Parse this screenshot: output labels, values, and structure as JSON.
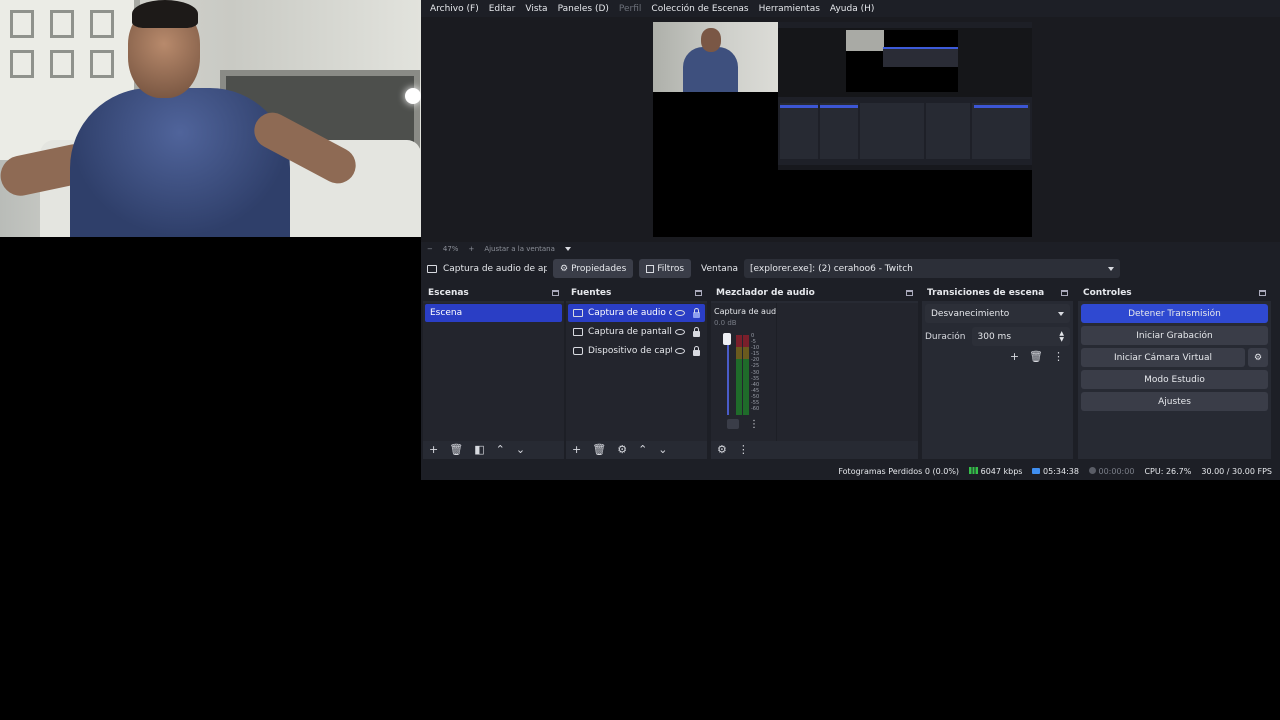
{
  "menubar": {
    "items": [
      {
        "label": "Archivo (F)",
        "enabled": true
      },
      {
        "label": "Editar",
        "enabled": true
      },
      {
        "label": "Vista",
        "enabled": true
      },
      {
        "label": "Paneles (D)",
        "enabled": true
      },
      {
        "label": "Perfil",
        "enabled": false
      },
      {
        "label": "Colección de Escenas",
        "enabled": true
      },
      {
        "label": "Herramientas",
        "enabled": true
      },
      {
        "label": "Ayuda (H)",
        "enabled": true
      }
    ]
  },
  "preview": {
    "zoom_minus": "−",
    "zoom_level": "47%",
    "zoom_plus": "+",
    "fit_label": "Ajustar a la ventana"
  },
  "source_toolbar": {
    "source_name": "Captura de audio de aplicación",
    "properties_label": "Propiedades",
    "filters_label": "Filtros",
    "window_label": "Ventana",
    "window_value": "[explorer.exe]: (2) cerahoo6 - Twitch"
  },
  "scenes": {
    "title": "Escenas",
    "items": [
      "Escena"
    ]
  },
  "sources": {
    "title": "Fuentes",
    "items": [
      {
        "label": "Captura de audio de aplicación",
        "icon": "app-audio-icon",
        "selected": true
      },
      {
        "label": "Captura de pantalla",
        "icon": "monitor-icon",
        "selected": false
      },
      {
        "label": "Dispositivo de captura de video",
        "icon": "camera-icon",
        "selected": false
      }
    ]
  },
  "mixer": {
    "title": "Mezclador de audio",
    "channel_label": "Captura de audio de aplicación",
    "db_value": "0.0 dB",
    "ticks": [
      "0",
      "-5",
      "-10",
      "-15",
      "-20",
      "-25",
      "-30",
      "-35",
      "-40",
      "-45",
      "-50",
      "-55",
      "-60"
    ]
  },
  "transitions": {
    "title": "Transiciones de escena",
    "selected": "Desvanecimiento",
    "duration_label": "Duración",
    "duration_value": "300 ms"
  },
  "controls": {
    "title": "Controles",
    "stop_stream": "Detener Transmisión",
    "start_recording": "Iniciar Grabación",
    "start_virtual_cam": "Iniciar Cámara Virtual",
    "studio_mode": "Modo Estudio",
    "settings": "Ajustes"
  },
  "statusbar": {
    "dropped_frames": "Fotogramas Perdidos 0 (0.0%)",
    "bitrate": "6047 kbps",
    "live_time": "05:34:38",
    "rec_time": "00:00:00",
    "cpu": "CPU: 26.7%",
    "fps": "30.00 / 30.00 FPS"
  },
  "colors": {
    "accent": "#2f49d1",
    "selection": "#2a3ec5",
    "window_bg": "#1d1f26",
    "dock_bg": "#272a33"
  }
}
